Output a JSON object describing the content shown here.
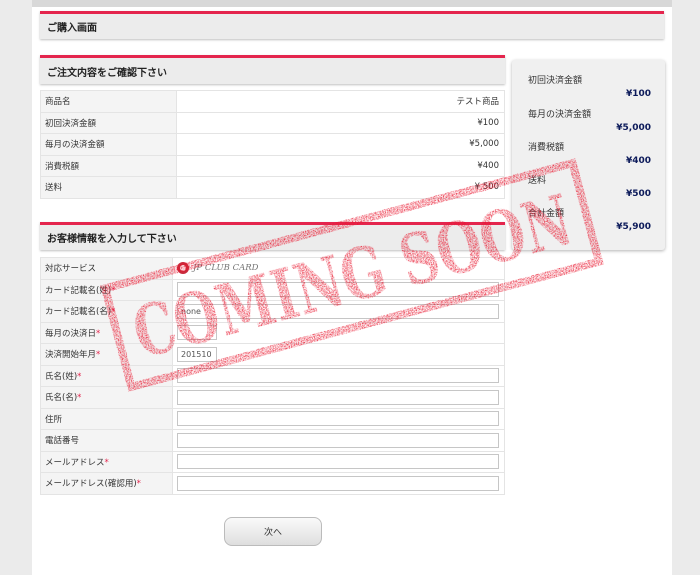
{
  "header": {
    "title": "ご購入画面"
  },
  "order": {
    "title": "ご注文内容をご確認下さい",
    "rows": [
      {
        "label": "商品名",
        "value": "テスト商品"
      },
      {
        "label": "初回決済金額",
        "value": "¥100"
      },
      {
        "label": "毎月の決済金額",
        "value": "¥5,000"
      },
      {
        "label": "消費税額",
        "value": "¥400"
      },
      {
        "label": "送料",
        "value": "¥ 500"
      }
    ]
  },
  "customer": {
    "title": "お客様情報を入力して下さい",
    "service_label": "対応サービス",
    "service_logo": "JP CLUB CARD",
    "fields": [
      {
        "label": "カード記載名(姓)",
        "required": "*",
        "value": ""
      },
      {
        "label": "カード記載名(名)",
        "required": "*",
        "value": "none"
      },
      {
        "label": "毎月の決済日",
        "required": "*",
        "value": ""
      },
      {
        "label": "決済開始年月",
        "required": "*",
        "value": "201510"
      },
      {
        "label": "氏名(姓)",
        "required": "*",
        "value": ""
      },
      {
        "label": "氏名(名)",
        "required": "*",
        "value": ""
      },
      {
        "label": "住所",
        "required": "",
        "value": ""
      },
      {
        "label": "電話番号",
        "required": "",
        "value": ""
      },
      {
        "label": "メールアドレス",
        "required": "*",
        "value": ""
      },
      {
        "label": "メールアドレス(確認用)",
        "required": "*",
        "value": ""
      }
    ]
  },
  "summary": [
    {
      "label": "初回決済金額",
      "value": "¥100"
    },
    {
      "label": "毎月の決済金額",
      "value": "¥5,000"
    },
    {
      "label": "消費税額",
      "value": "¥400"
    },
    {
      "label": "送料",
      "value": "¥500"
    },
    {
      "label": "合計金額",
      "value": "¥5,900"
    }
  ],
  "next_button": "次へ",
  "stamp": {
    "text": "COMING SOON",
    "color": "#e8132a"
  },
  "colors": {
    "accent": "#e4254d",
    "summary_value": "#0c1a5a"
  }
}
